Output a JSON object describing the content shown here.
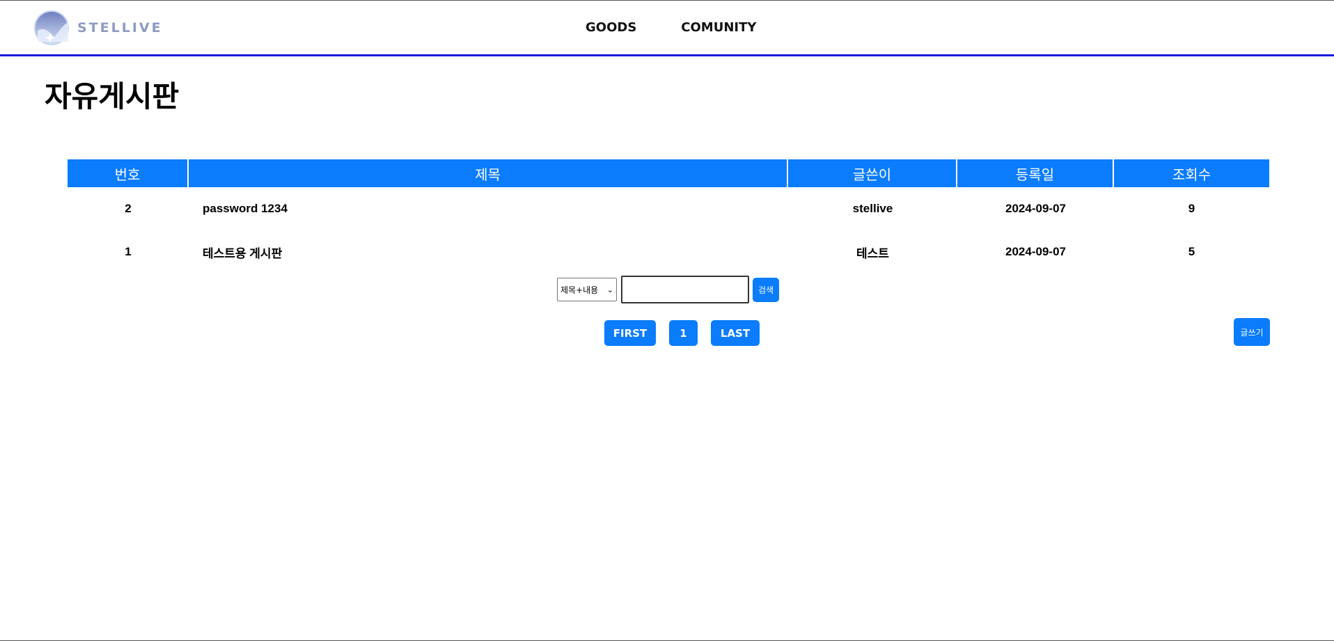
{
  "header": {
    "logo_text": "STELLIVE",
    "nav": [
      {
        "label": "GOODS"
      },
      {
        "label": "COMUNITY"
      }
    ]
  },
  "page": {
    "title": "자유게시판"
  },
  "board": {
    "columns": [
      "번호",
      "제목",
      "글쓴이",
      "등록일",
      "조회수"
    ],
    "rows": [
      {
        "no": "2",
        "title": "password 1234",
        "author": "stellive",
        "date": "2024-09-07",
        "views": "9"
      },
      {
        "no": "1",
        "title": "테스트용 게시판",
        "author": "테스트",
        "date": "2024-09-07",
        "views": "5"
      }
    ]
  },
  "search": {
    "select_value": "제목+내용",
    "input_value": "",
    "button_label": "검색"
  },
  "pagination": {
    "first_label": "FIRST",
    "pages": [
      "1"
    ],
    "last_label": "LAST"
  },
  "write_button_label": "글쓰기",
  "colors": {
    "accent": "#0b7cfb",
    "nav_border": "#1a1adb",
    "logo": "#8d9bc4"
  }
}
